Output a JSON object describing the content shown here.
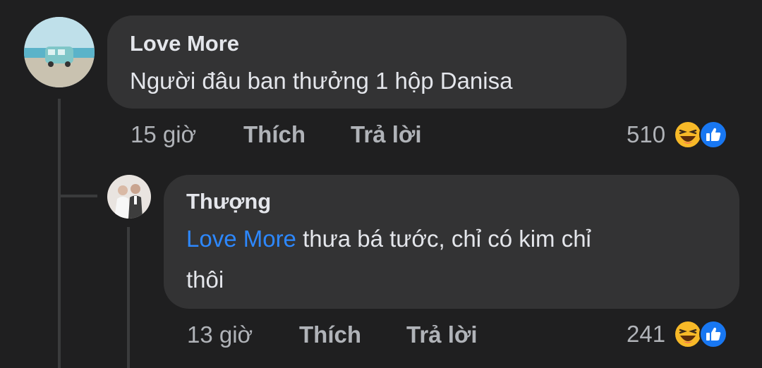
{
  "comments": [
    {
      "author": "Love More",
      "text": "Người đâu ban thưởng 1 hộp Danisa",
      "time": "15 giờ",
      "like_label": "Thích",
      "reply_label": "Trả lời",
      "reaction_count": "510",
      "reactions": [
        "haha-icon",
        "like-icon"
      ]
    },
    {
      "author": "Thượng",
      "mention": "Love More",
      "text": "thưa bá tước, chỉ có kim chỉ",
      "text_line2": "thôi",
      "time": "13 giờ",
      "like_label": "Thích",
      "reply_label": "Trả lời",
      "reaction_count": "241",
      "reactions": [
        "haha-icon",
        "like-icon"
      ]
    }
  ],
  "colors": {
    "background": "#1f1f20",
    "bubble": "#333334",
    "mention": "#2d88ff",
    "like_blue": "#1877f2",
    "haha_yellow": "#f7b928"
  }
}
